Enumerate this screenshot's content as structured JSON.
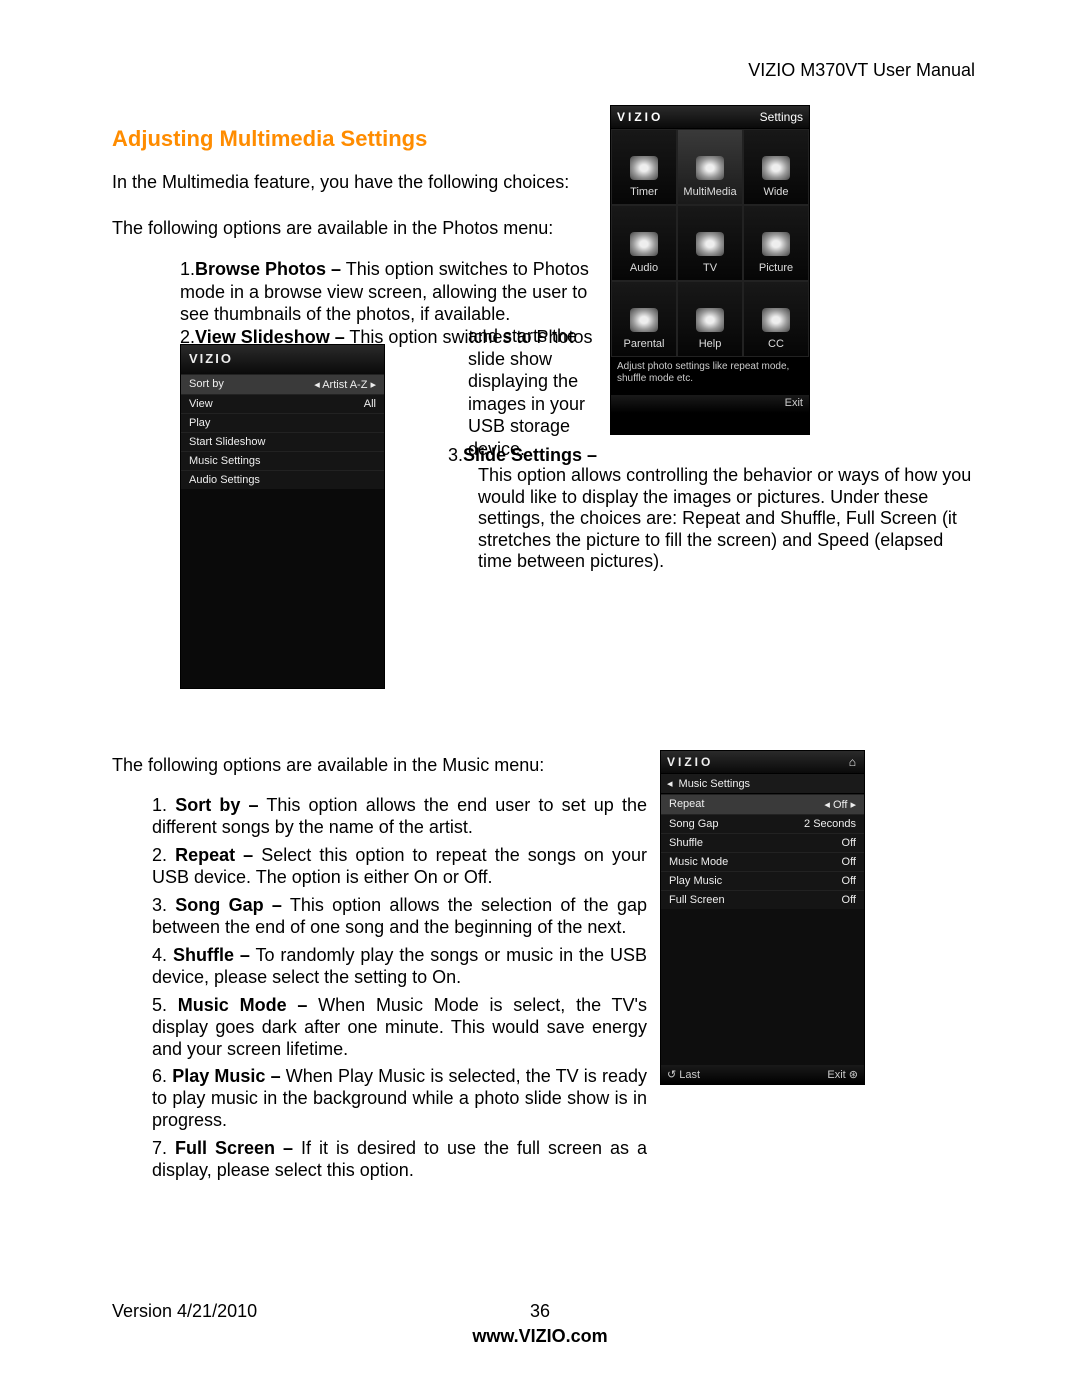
{
  "header": {
    "right": "VIZIO M370VT User Manual"
  },
  "section_title": "Adjusting Multimedia Settings",
  "intro1": "In the Multimedia feature, you have the following choices:",
  "intro2": "The following options are available in the Photos menu:",
  "photos_items": {
    "item1": {
      "num": "1.",
      "label": "Browse Photos –",
      "text": " This option switches to Photos mode in a browse view screen, allowing the user to see thumbnails of the photos, if available."
    },
    "item2": {
      "num": "2.",
      "label": "View Slideshow –",
      "lead": " This option switches to Photos mode",
      "cont": "and starts the slide show displaying the images in your USB storage device."
    },
    "item3": {
      "num": "3.",
      "label": "Slide Settings –",
      "text": "This option allows controlling the behavior or ways of how you would like to display the images or pictures. Under these settings, the choices are: Repeat and Shuffle, Full Screen (it stretches the picture to fill the screen) and Speed (elapsed time between pictures)."
    }
  },
  "osd1": {
    "brand": "VIZIO",
    "title": "Settings",
    "items": [
      {
        "label": "Timer"
      },
      {
        "label": "MultiMedia"
      },
      {
        "label": "Wide"
      },
      {
        "label": "Audio"
      },
      {
        "label": "TV"
      },
      {
        "label": "Picture"
      },
      {
        "label": "Parental"
      },
      {
        "label": "Help"
      },
      {
        "label": "CC"
      }
    ],
    "help": "Adjust photo settings like repeat mode, shuffle mode etc.",
    "exit": "Exit"
  },
  "osd2": {
    "brand": "VIZIO",
    "rows": [
      {
        "l": "Sort by",
        "r": "◂ Artist A-Z ▸",
        "sel": true
      },
      {
        "l": "View",
        "r": "All"
      },
      {
        "l": "Play",
        "r": ""
      },
      {
        "l": "Start Slideshow",
        "r": ""
      },
      {
        "l": "Music Settings",
        "r": ""
      },
      {
        "l": "Audio Settings",
        "r": ""
      }
    ]
  },
  "music_intro": "The following options are available in the Music menu:",
  "music_items": [
    {
      "num": "1.",
      "label": "Sort by –",
      "text": " This option allows the end user to set up the different songs by the name of the artist."
    },
    {
      "num": "2.",
      "label": "Repeat –",
      "text": " Select this option to repeat the songs on your USB device. The option is either On or Off."
    },
    {
      "num": "3.",
      "label": "Song Gap –",
      "text": " This option allows the selection of the gap between the end of one song and the beginning of the next."
    },
    {
      "num": "4.",
      "label": "Shuffle –",
      "text": " To randomly play the songs or music in the USB device, please select the setting to On."
    },
    {
      "num": "5.",
      "label": "Music Mode –",
      "text": " When Music Mode is select, the TV's display goes dark after one minute. This would save energy and your screen lifetime."
    },
    {
      "num": "6.",
      "label": "Play Music –",
      "text": " When Play Music is selected, the TV is ready to play music in the background while a photo slide show is in progress."
    },
    {
      "num": "7.",
      "label": "Full Screen –",
      "text": " If it is desired to use the full screen as a display, please select this option."
    }
  ],
  "osd3": {
    "brand": "VIZIO",
    "home_icon": "⌂",
    "crumb_arrow": "◂",
    "crumb": "Music Settings",
    "rows": [
      {
        "l": "Repeat",
        "r": "◂ Off ▸",
        "sel": true
      },
      {
        "l": "Song Gap",
        "r": "2 Seconds"
      },
      {
        "l": "Shuffle",
        "r": "Off"
      },
      {
        "l": "Music Mode",
        "r": "Off"
      },
      {
        "l": "Play Music",
        "r": "Off"
      },
      {
        "l": "Full Screen",
        "r": "Off"
      }
    ],
    "last": "↺ Last",
    "exit": "Exit ⊛"
  },
  "footer": {
    "version": "Version 4/21/2010",
    "page": "36",
    "url": "www.VIZIO.com"
  }
}
